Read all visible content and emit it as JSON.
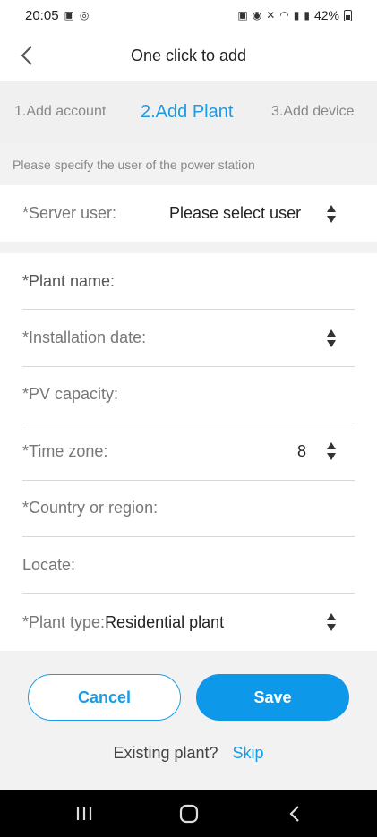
{
  "status_bar": {
    "time": "20:05",
    "battery": "42%"
  },
  "header": {
    "title": "One click to add"
  },
  "steps": [
    {
      "label": "1.Add account"
    },
    {
      "label": "2.Add Plant"
    },
    {
      "label": "3.Add device"
    }
  ],
  "hint": "Please specify the user of the power station",
  "server_user": {
    "label": "*Server user:",
    "value": "Please select user"
  },
  "form": {
    "plant_name": {
      "label": "*Plant name:"
    },
    "installation_date": {
      "label": "*Installation date:"
    },
    "pv_capacity": {
      "label": "*PV capacity:"
    },
    "time_zone": {
      "label": "*Time zone:",
      "value": "8"
    },
    "country": {
      "label": "*Country or region:"
    },
    "locate": {
      "label": "Locate:"
    },
    "plant_type": {
      "label": "*Plant type:",
      "value": "Residential plant"
    }
  },
  "buttons": {
    "cancel": "Cancel",
    "save": "Save"
  },
  "existing": {
    "question": "Existing plant?",
    "skip": "Skip"
  },
  "colors": {
    "accent": "#1a9be6",
    "save_bg": "#0e98ea"
  }
}
